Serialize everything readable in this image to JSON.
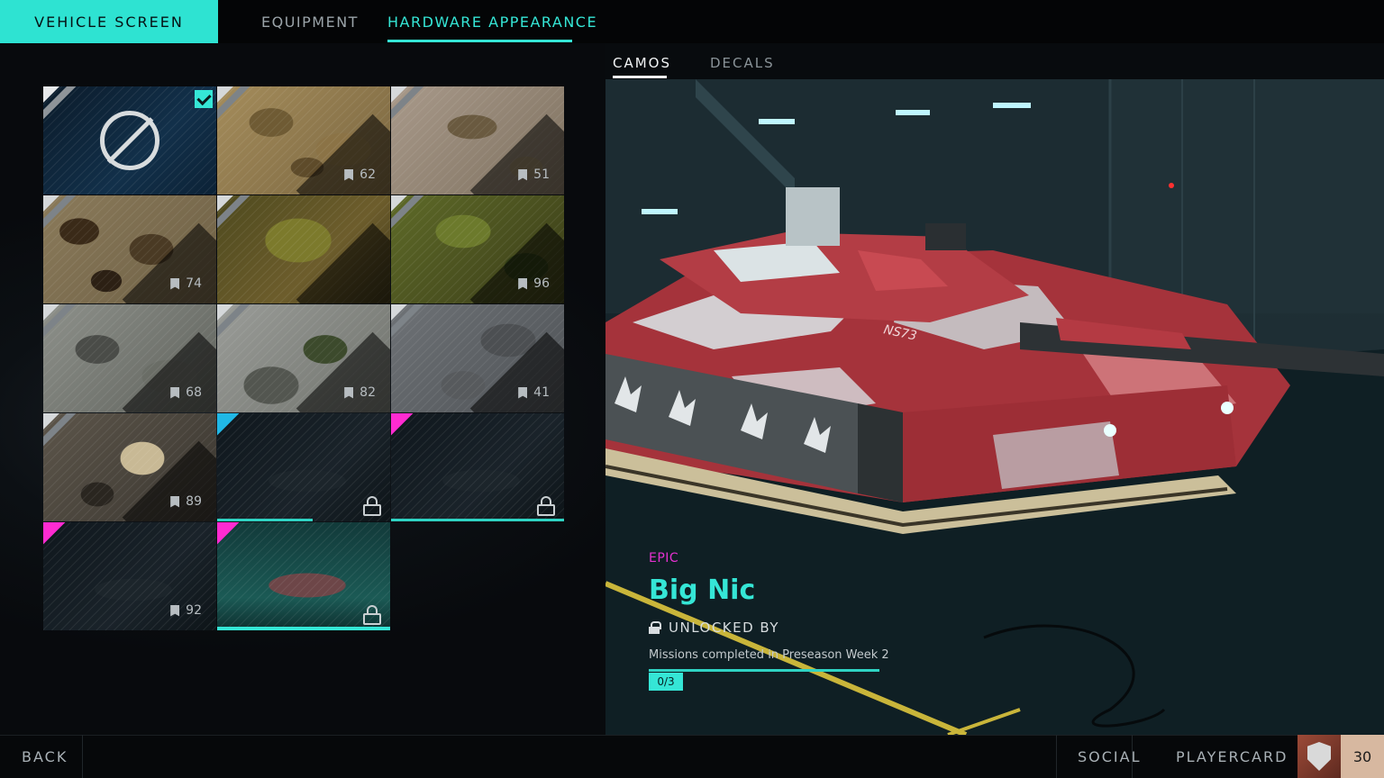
{
  "tabs": {
    "vehicle_screen": "VEHICLE SCREEN",
    "equipment": "EQUIPMENT",
    "hardware_appearance": "HARDWARE APPEARANCE"
  },
  "subtabs": {
    "camos": "CAMOS",
    "decals": "DECALS"
  },
  "camo_counts": [
    "62",
    "51",
    "74",
    "96",
    "68",
    "82",
    "41",
    "89",
    "92"
  ],
  "selected": {
    "rarity": "EPIC",
    "name": "Big Nic",
    "unlock_label": "UNLOCKED BY",
    "description": "Missions completed in Preseason Week 2",
    "progress": "0/3"
  },
  "vehicle": {
    "marking": "NS73"
  },
  "bottom": {
    "back": "BACK",
    "social": "SOCIAL",
    "playercard": "PLAYERCARD",
    "level": "30"
  },
  "colors": {
    "accent": "#35e6d6",
    "epic": "#e431d0",
    "rare": "#20b8e6"
  }
}
